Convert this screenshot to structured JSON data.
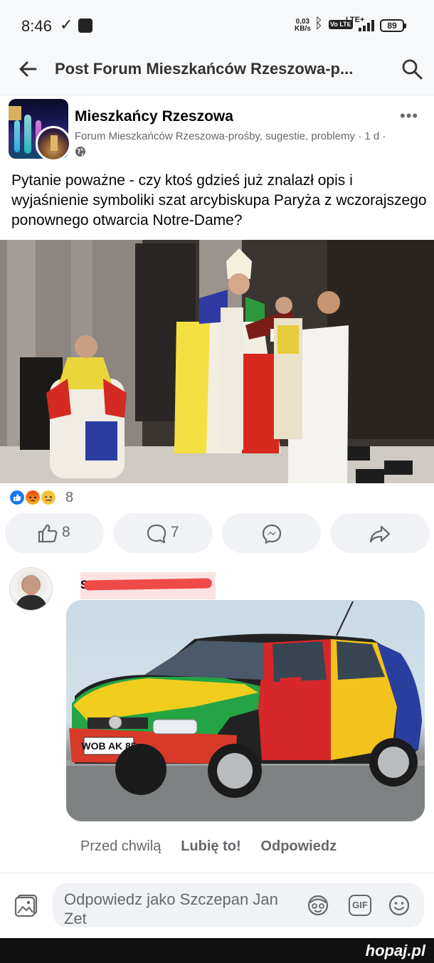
{
  "status_bar": {
    "time": "8:46",
    "network_speed_value": "0,03",
    "network_speed_unit": "KB/s",
    "network_type": "LTE+",
    "volte": "Vo LTE",
    "battery": "89"
  },
  "header": {
    "title": "Post Forum Mieszkańców Rzeszowa-p..."
  },
  "post": {
    "author": "Mieszkańcy Rzeszowa",
    "group": "Forum Mieszkańców Rzeszowa-prośby, sugestie, problemy",
    "time": "1 d",
    "separator": "·",
    "text": "Pytanie poważne - czy ktoś gdzieś już znalazł opis i wyjaśnienie symboliki szat arcybiskupa Paryża z wczorajszego ponownego otwarcia Notre-Dame?",
    "reaction_count": "8",
    "reactions": [
      "like",
      "angry",
      "sad"
    ]
  },
  "actions": {
    "like_count": "8",
    "comment_count": "7"
  },
  "comment": {
    "author_initial": "S",
    "license_plate": "WOB AK 85",
    "time": "Przed chwilą",
    "like_label": "Lubię to!",
    "reply_label": "Odpowiedz"
  },
  "reply_bar": {
    "placeholder": "Odpowiedz jako Szczepan Jan Zet",
    "gif_label": "GIF"
  },
  "watermark": "hopaj.pl",
  "colors": {
    "facebook_blue": "#1877f2",
    "secondary_text": "#65676b",
    "redaction": "#ee4a4a"
  }
}
